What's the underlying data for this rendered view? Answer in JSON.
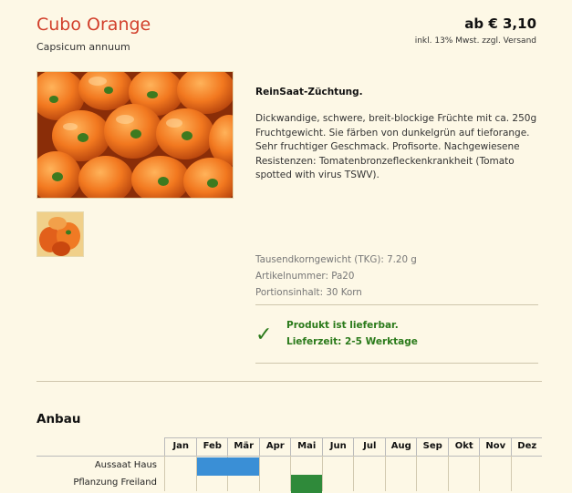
{
  "product": {
    "name": "Cubo Orange",
    "latin_name": "Capsicum annuum",
    "price": "ab € 3,10",
    "price_note": "inkl. 13% Mwst. zzgl. Versand"
  },
  "description": {
    "title": "ReinSaat-Züchtung.",
    "body": "Dickwandige, schwere, breit-blockige Früchte mit ca. 250g Fruchtgewicht. Sie färben von dunkelgrün auf tieforange. Sehr fruchtiger Geschmack. Profisorte. Nachgewiesene Resistenzen: Tomatenbronzefleckenkrankheit (Tomato spotted with virus TSWV)."
  },
  "facts": {
    "tkg": "Tausendkorngewicht (TKG): 7.20 g",
    "article_number": "Artikelnummer: Pa20",
    "portion": "Portionsinhalt: 30 Korn"
  },
  "availability": {
    "status": "Produkt ist lieferbar.",
    "delivery": "Lieferzeit: 2-5 Werktage",
    "color": "#2a7a1a"
  },
  "cultivation": {
    "title": "Anbau",
    "months": [
      "Jan",
      "Feb",
      "Mär",
      "Apr",
      "Mai",
      "Jun",
      "Jul",
      "Aug",
      "Sep",
      "Okt",
      "Nov",
      "Dez"
    ],
    "rows": [
      {
        "label": "Aussaat Haus",
        "months": [
          "Feb",
          "Mär"
        ],
        "color": "#3a8fd6"
      },
      {
        "label": "Pflanzung Freiland",
        "months": [
          "Mai"
        ],
        "color": "#2f8a3a"
      }
    ]
  },
  "images": {
    "main": "orange-peppers-photo",
    "thumbnail": "peppers-thumbnail"
  },
  "colors": {
    "title": "#d2402c",
    "background": "#fdf8e6"
  }
}
